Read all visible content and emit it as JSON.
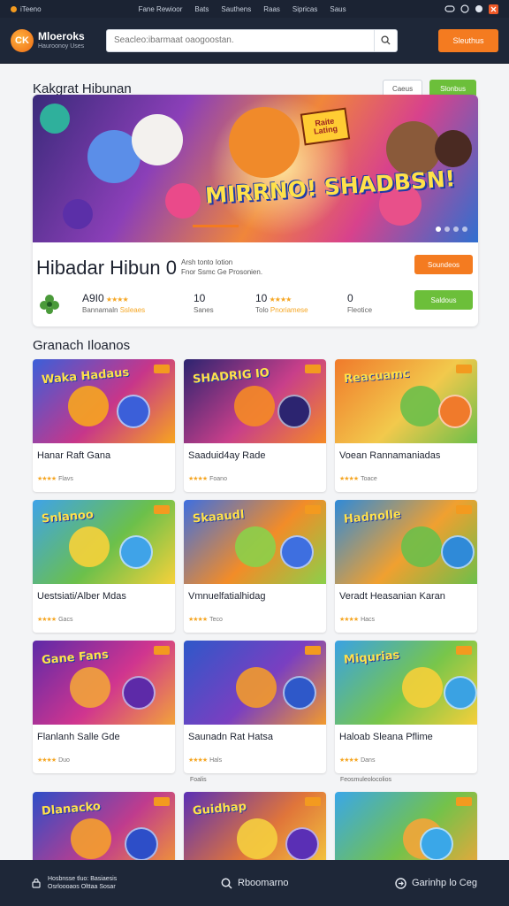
{
  "topbar": {
    "brand": "iTeeno",
    "links": [
      "Fane Rewioor",
      "Bats",
      "Sauthens",
      "Raas",
      "Sipricas",
      "Saus"
    ]
  },
  "header": {
    "logo_badge": "CK",
    "logo_title": "Mloeroks",
    "logo_sub": "Hauroonoy Uses",
    "search_placeholder": "Seacleo:ibarmaat oaogoostan.",
    "cta_label": "Sleuthus"
  },
  "featured": {
    "section_title": "Kakgrat Hibunan",
    "btn_ghost": "Caeus",
    "btn_green": "Slonbus",
    "banner_badge": "Raite Lating",
    "banner_art": "MIRRNO! SHADBSN!",
    "name": "Hibadar Hibun 0",
    "desc_lines": [
      "Arsh tonto Iotion",
      "Fnor Ssmc Ge Prosonien."
    ],
    "btn_orange": "Soundeos",
    "btn_green2": "Saldous",
    "stats": [
      {
        "value": "A9I0",
        "label": "Bannamaln",
        "sub": "Ssleaes"
      },
      {
        "value": "10",
        "label": "Sanes"
      },
      {
        "value": "10",
        "label": "Tolo",
        "sub": "Pnoriamese"
      },
      {
        "value": "0",
        "label": "Fleotice"
      }
    ],
    "rating_stars": "★★★★"
  },
  "games": {
    "section_title": "Granach Iloanos",
    "items": [
      {
        "name": "Hanar Raft Gana",
        "rating": "★★★★",
        "count": "Flavs",
        "art": "Waka Hadaus",
        "colors": [
          "#3b5fd9",
          "#c7368a",
          "#f7a51f"
        ]
      },
      {
        "name": "Saaduid4ay Rade",
        "rating": "★★★★",
        "count": "Foano",
        "art": "SHADRIG IO",
        "colors": [
          "#2c2470",
          "#c83f8a",
          "#f58a25"
        ]
      },
      {
        "name": "Voean Rannamaniadas",
        "rating": "★★★★",
        "count": "Toace",
        "art": "Reacuamc",
        "colors": [
          "#f07a2b",
          "#f2c94c",
          "#6bbf4a"
        ]
      },
      {
        "name": "Uestsiati/Alber Mdas",
        "rating": "★★★★",
        "count": "Gacs",
        "art": "Snlanoo",
        "colors": [
          "#3fa3e8",
          "#6bc04b",
          "#f7d13a"
        ]
      },
      {
        "name": "Vmnuelfatialhidag",
        "rating": "★★★★",
        "count": "Teco",
        "art": "Skaaudl",
        "colors": [
          "#3e6fe0",
          "#f28c28",
          "#8bd04a"
        ]
      },
      {
        "name": "Veradt Heasanian Karan",
        "rating": "★★★★",
        "count": "Hacs",
        "art": "Hadnolle",
        "colors": [
          "#2f8ad8",
          "#f0a030",
          "#6cbf4a"
        ]
      },
      {
        "name": "Flanlanh Salle Gde",
        "rating": "★★★★",
        "count": "Duo",
        "art": "Gane Fans",
        "colors": [
          "#5d2aa8",
          "#d0358f",
          "#f2a33a"
        ]
      },
      {
        "name": "Saunadn Rat Hatsa",
        "rating": "★★★★",
        "count": "Hals",
        "art": "",
        "colors": [
          "#2e58c9",
          "#7a3fc1",
          "#f29a2c"
        ]
      },
      {
        "name": "Haloab Sleana Pflime",
        "rating": "★★★★",
        "count": "Dans",
        "art": "Miqurias",
        "colors": [
          "#3aa2e3",
          "#78c64a",
          "#f6cf3a"
        ]
      },
      {
        "name": "",
        "rating": "",
        "count": "",
        "art": "Dlanacko",
        "colors": [
          "#2d4ec8",
          "#c03c8d",
          "#f59e2e"
        ]
      },
      {
        "name": "",
        "rating": "",
        "count": "",
        "art": "Guidhap",
        "colors": [
          "#5a2fb5",
          "#e0753a",
          "#f5cf3f"
        ]
      },
      {
        "name": "",
        "rating": "",
        "count": "",
        "art": "",
        "colors": [
          "#3aa7e8",
          "#74c24a",
          "#f3a53a"
        ]
      }
    ],
    "row_notes": [
      "Foalis",
      "Feosmuleolocolios"
    ]
  },
  "bottombar": {
    "left_line1": "Hosbnsse tluo: Basiaesis",
    "left_line2": "Osrloooaos Olttaa Sosar",
    "middle": "Rboomarno",
    "right": "Garinhp lo Ceg"
  }
}
